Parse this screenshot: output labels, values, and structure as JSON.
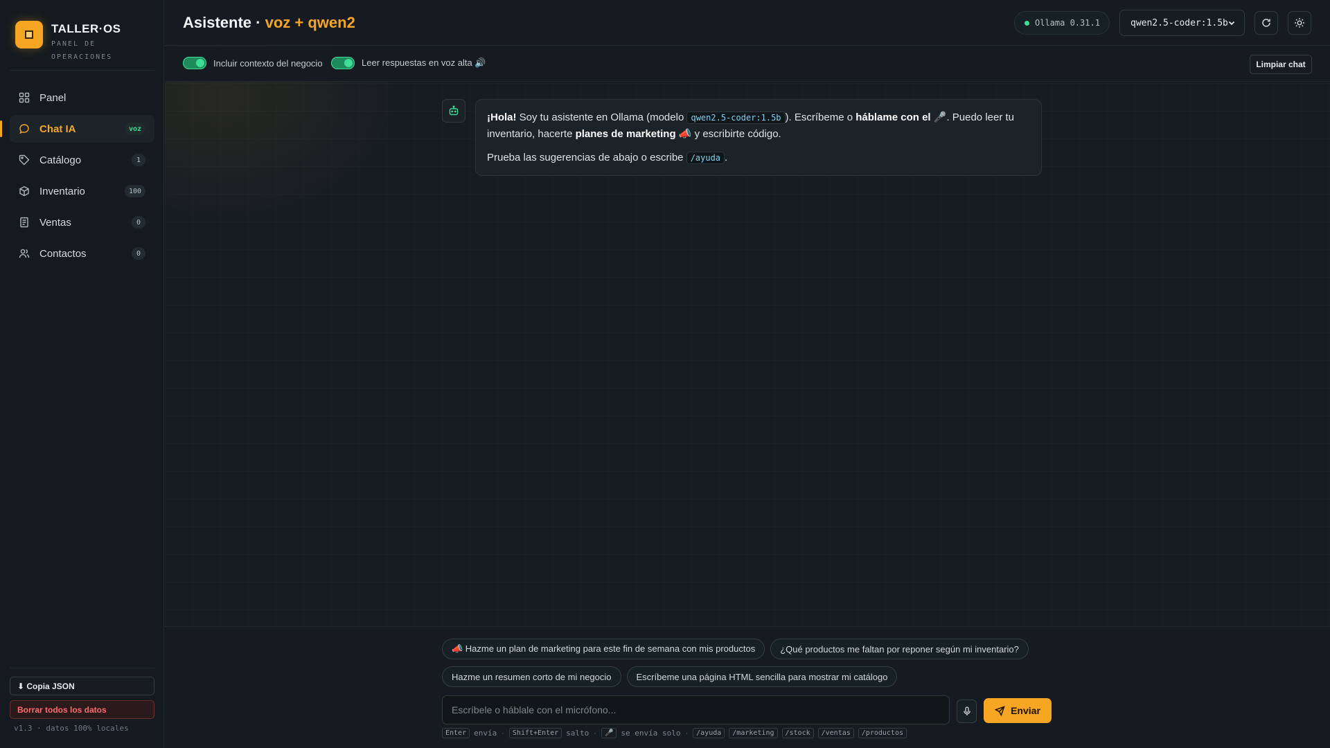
{
  "brand": {
    "name": "TALLER·OS",
    "subtitle": "PANEL DE OPERACIONES"
  },
  "sidebar": {
    "items": [
      {
        "label": "Panel",
        "icon": "grid-icon",
        "badge": null,
        "active": false
      },
      {
        "label": "Chat IA",
        "icon": "chat-icon",
        "badge": "voz",
        "active": true
      },
      {
        "label": "Catálogo",
        "icon": "tag-icon",
        "badge": "1",
        "active": false
      },
      {
        "label": "Inventario",
        "icon": "box-icon",
        "badge": "100",
        "active": false
      },
      {
        "label": "Ventas",
        "icon": "receipt-icon",
        "badge": "0",
        "active": false
      },
      {
        "label": "Contactos",
        "icon": "users-icon",
        "badge": "0",
        "active": false
      }
    ],
    "copy_json": "⬇ Copia JSON",
    "delete_all": "Borrar todos los datos",
    "version": "v1.3 · datos 100% locales"
  },
  "header": {
    "title": "Asistente ·",
    "title_accent": "voz + qwen2",
    "status": "Ollama 0.31.1",
    "model": "qwen2.5-coder:1.5b"
  },
  "toolbar": {
    "toggle_context": "Incluir contexto del negocio",
    "toggle_voice": "Leer respuestas en voz alta 🔊",
    "clear_chat": "Limpiar chat"
  },
  "message": {
    "hello": "¡Hola!",
    "t1": " Soy tu asistente en Ollama (modelo ",
    "model_code": "qwen2.5-coder:1.5b",
    "t2": "). Escríbeme o ",
    "bold1": "háblame con el",
    "t3": " 🎤. Puedo leer tu inventario, hacerte ",
    "bold2": "planes de marketing",
    "t4": " 📣 y escribirte código.",
    "p2": "Prueba las sugerencias de abajo o escribe ",
    "help_code": "/ayuda",
    "p2_end": "."
  },
  "suggestions": {
    "row1": [
      "📣 Hazme un plan de marketing para este fin de semana con mis productos",
      "¿Qué productos me faltan por reponer según mi inventario?"
    ],
    "row2": [
      "Hazme un resumen corto de mi negocio",
      "Escríbeme una página HTML sencilla para mostrar mi catálogo"
    ]
  },
  "composer": {
    "placeholder": "Escríbele o háblale con el micrófono...",
    "send": "Enviar"
  },
  "hints": {
    "enter": "Enter",
    "enter_txt": "envía",
    "shift": "Shift+Enter",
    "shift_txt": "salto",
    "mic": "🎤",
    "mic_txt": "se envía solo",
    "commands": [
      "/ayuda",
      "/marketing",
      "/stock",
      "/ventas",
      "/productos"
    ]
  },
  "colors": {
    "accent": "#f6a623",
    "success": "#3ddc97",
    "danger": "#ff6b6b"
  }
}
